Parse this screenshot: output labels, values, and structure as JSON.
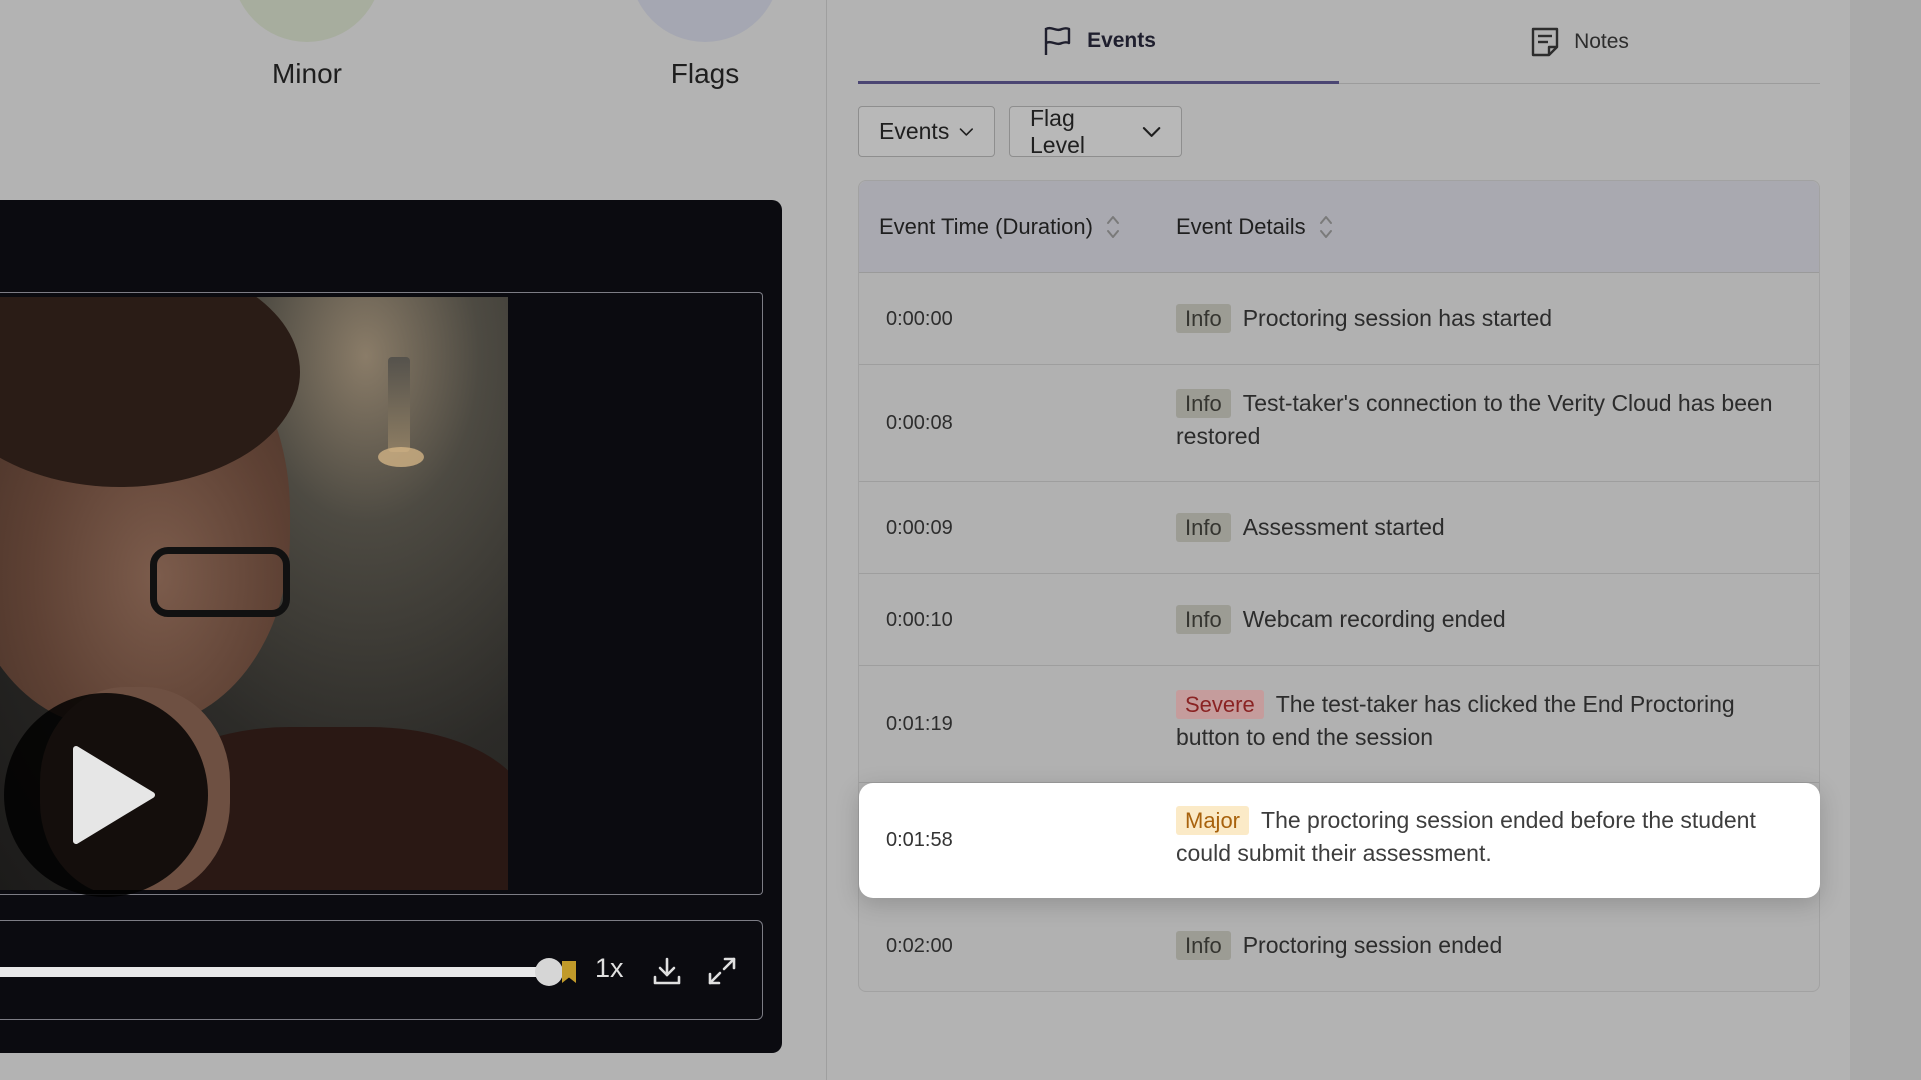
{
  "summary": {
    "minor_label": "Minor",
    "flags_label": "Flags"
  },
  "player": {
    "speed": "1x",
    "progress_fraction": 0.96,
    "icons": [
      "play-icon",
      "download-icon",
      "fullscreen-icon"
    ]
  },
  "tabs": [
    {
      "label": "Events",
      "icon": "flag-icon",
      "active": true
    },
    {
      "label": "Notes",
      "icon": "notes-icon",
      "active": false
    }
  ],
  "filters": {
    "events_label": "Events",
    "flag_level_label": "Flag Level"
  },
  "table": {
    "headers": {
      "time": "Event Time (Duration)",
      "details": "Event Details"
    },
    "rows": [
      {
        "time": "0:00:00",
        "level": "Info",
        "text": "Proctoring session has started"
      },
      {
        "time": "0:00:08",
        "level": "Info",
        "text": "Test-taker's connection to the Verity Cloud has been restored"
      },
      {
        "time": "0:00:09",
        "level": "Info",
        "text": "Assessment started"
      },
      {
        "time": "0:00:10",
        "level": "Info",
        "text": "Webcam recording ended"
      },
      {
        "time": "0:01:19",
        "level": "Severe",
        "text": "The test-taker has clicked the End Proctoring button to end the session"
      },
      {
        "time": "0:01:58",
        "level": "Major",
        "text": "The proctoring session ended before the student could submit their assessment."
      },
      {
        "time": "0:02:00",
        "level": "Info",
        "text": "Proctoring session ended"
      }
    ]
  },
  "colors": {
    "accent": "#4b4673",
    "severe": "#8a2323",
    "major": "#a8620d",
    "overlay": "#b3b3b3"
  }
}
